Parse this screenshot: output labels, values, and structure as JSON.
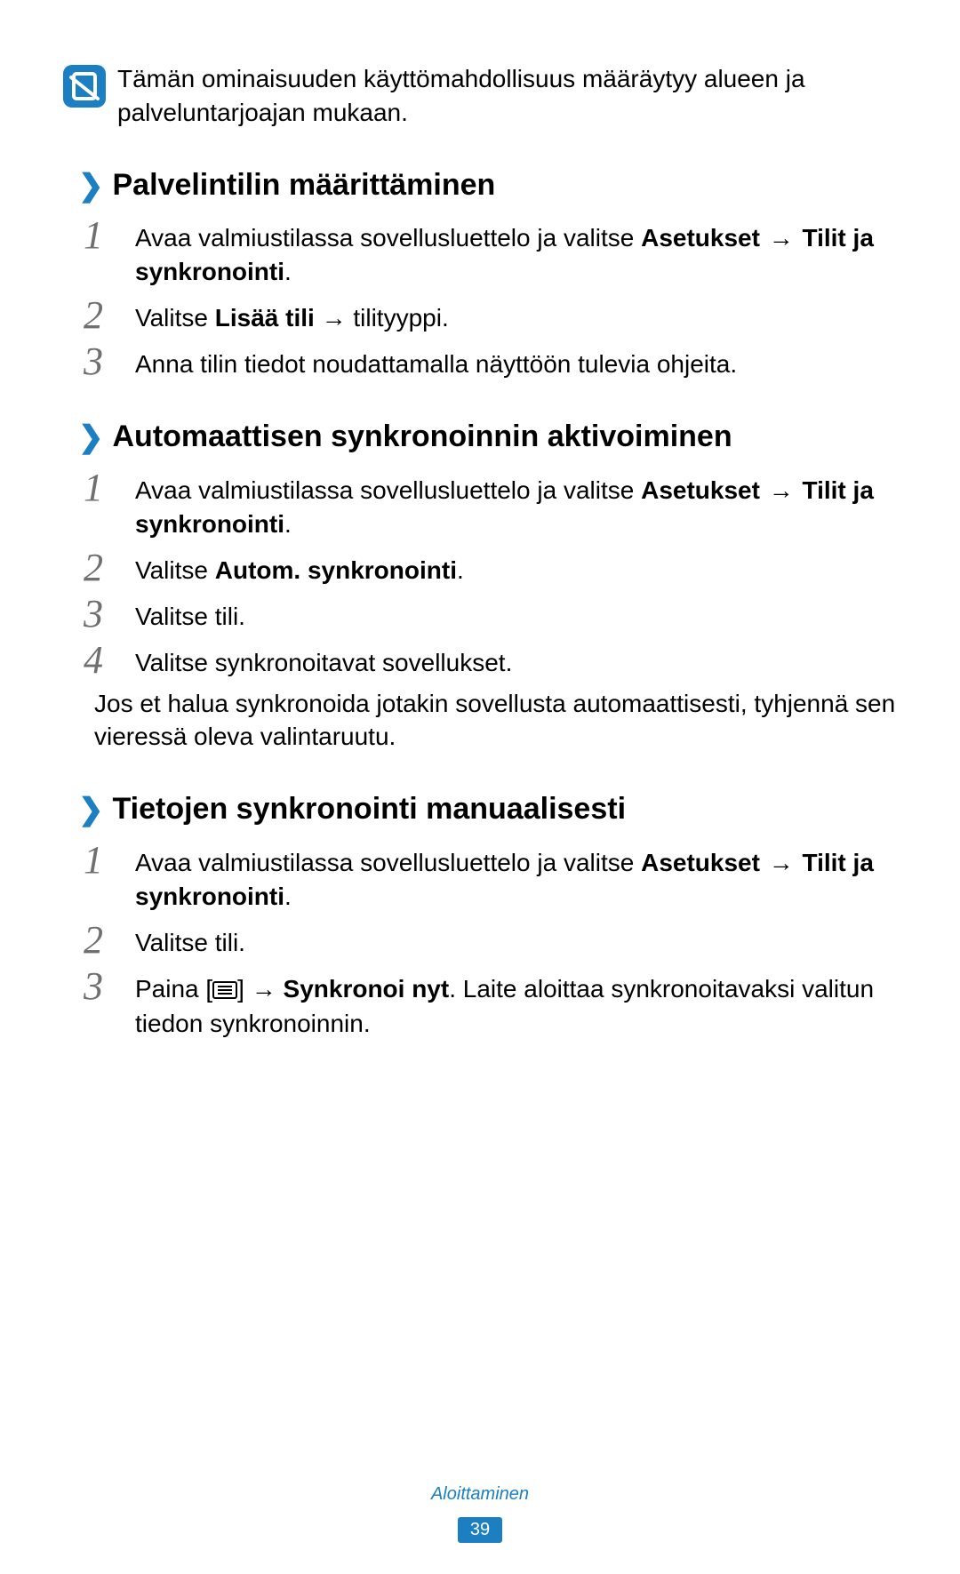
{
  "note": {
    "text": "Tämän ominaisuuden käyttömahdollisuus määräytyy alueen ja palveluntarjoajan mukaan."
  },
  "section1": {
    "title": "Palvelintilin määrittäminen",
    "step1_a": "Avaa valmiustilassa sovellusluettelo ja valitse ",
    "step1_b": "Asetukset",
    "step1_c": " → ",
    "step1_d": "Tilit ja synkronointi",
    "step1_e": ".",
    "step2_a": "Valitse ",
    "step2_b": "Lisää tili",
    "step2_c": " → tilityyppi.",
    "step3": "Anna tilin tiedot noudattamalla näyttöön tulevia ohjeita."
  },
  "section2": {
    "title": "Automaattisen synkronoinnin aktivoiminen",
    "step1_a": "Avaa valmiustilassa sovellusluettelo ja valitse ",
    "step1_b": "Asetukset",
    "step1_c": " → ",
    "step1_d": "Tilit ja synkronointi",
    "step1_e": ".",
    "step2_a": "Valitse ",
    "step2_b": "Autom. synkronointi",
    "step2_c": ".",
    "step3": "Valitse tili.",
    "step4": "Valitse synkronoitavat sovellukset.",
    "para": "Jos et halua synkronoida jotakin sovellusta automaattisesti, tyhjennä sen vieressä oleva valintaruutu."
  },
  "section3": {
    "title": "Tietojen synkronointi manuaalisesti",
    "step1_a": "Avaa valmiustilassa sovellusluettelo ja valitse ",
    "step1_b": "Asetukset",
    "step1_c": " → ",
    "step1_d": "Tilit ja synkronointi",
    "step1_e": ".",
    "step2": "Valitse tili.",
    "step3_a": "Paina [",
    "step3_b": "] → ",
    "step3_c": "Synkronoi nyt",
    "step3_d": ". Laite aloittaa synkronoitavaksi valitun tiedon synkronoinnin."
  },
  "footer": {
    "section": "Aloittaminen",
    "page": "39"
  },
  "nums": {
    "n1": "1",
    "n2": "2",
    "n3": "3",
    "n4": "4"
  }
}
